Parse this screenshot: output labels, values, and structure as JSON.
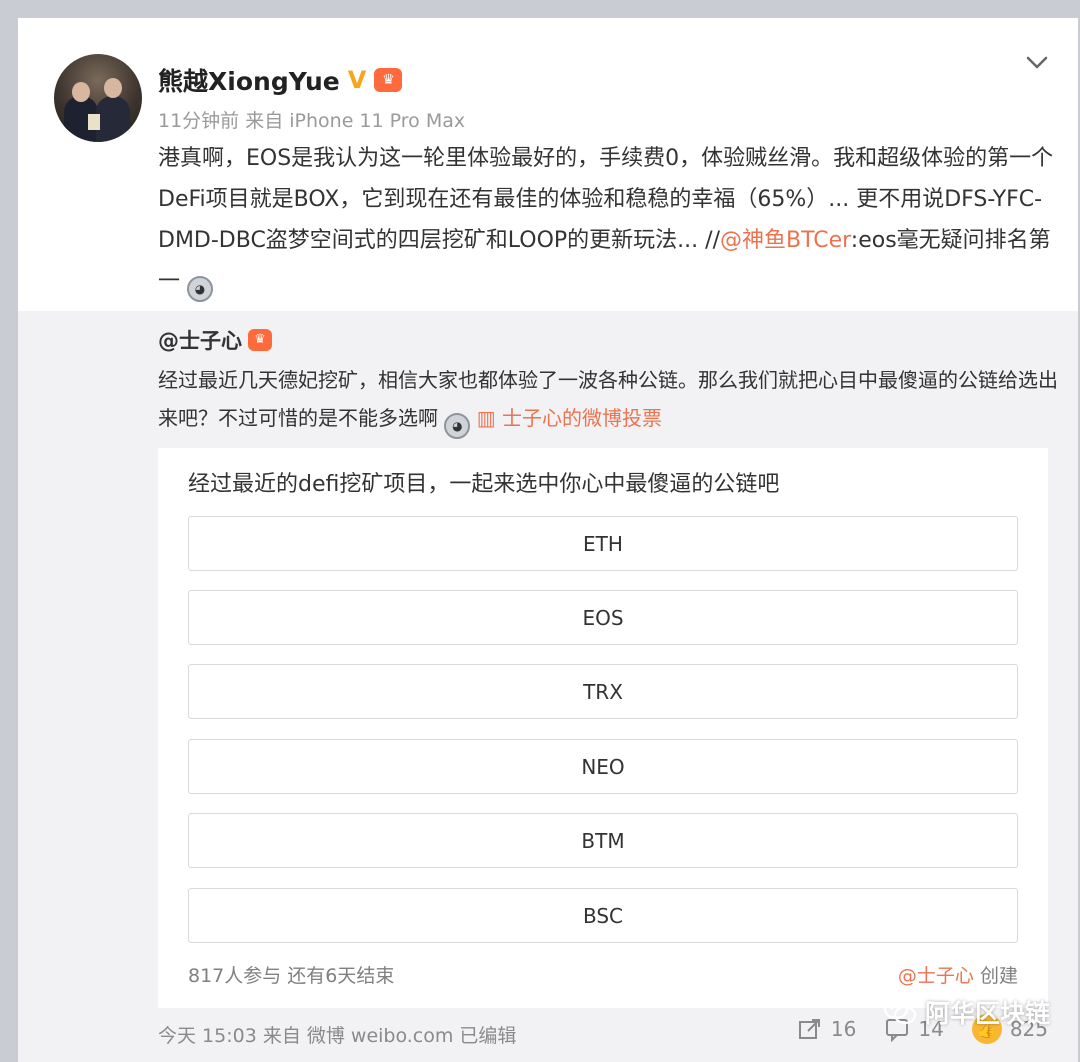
{
  "post": {
    "author": "熊越XiongYue",
    "verified_mark": "V",
    "meta": "11分钟前 来自 iPhone 11 Pro Max",
    "text_before_mention": "港真啊，EOS是我认为这一轮里体验最好的，手续费0，体验贼丝滑。我和超级体验的第一个DeFi项目就是BOX，它到现在还有最佳的体验和稳稳的幸福（65%）... 更不用说DFS-YFC-DMD-DBC盗梦空间式的四层挖矿和LOOP的更新玩法... //",
    "mention": "@神鱼BTCer",
    "text_after_mention": ":eos毫无疑问排名第一"
  },
  "repost": {
    "author": "@士子心",
    "text": "经过最近几天德妃挖矿，相信大家也都体验了一波各种公链。那么我们就把心目中最傻逼的公链给选出来吧？不过可惜的是不能多选啊",
    "vote_link": "士子心的微博投票",
    "poll": {
      "title": "经过最近的defi挖矿项目，一起来选中你心中最傻逼的公链吧",
      "options": [
        "ETH",
        "EOS",
        "TRX",
        "NEO",
        "BTM",
        "BSC"
      ],
      "participants": "817人参与 还有6天结束",
      "creator": "@士子心",
      "created_label": "创建"
    }
  },
  "footer": {
    "meta": "今天 15:03 来自 微博 weibo.com   已编辑",
    "shares": "16",
    "comments": "14",
    "likes": "825"
  },
  "watermark": "阿华区块链",
  "colors": {
    "link": "#eb7350",
    "verified": "#f7a51c",
    "repost_bg": "#f2f2f5"
  }
}
